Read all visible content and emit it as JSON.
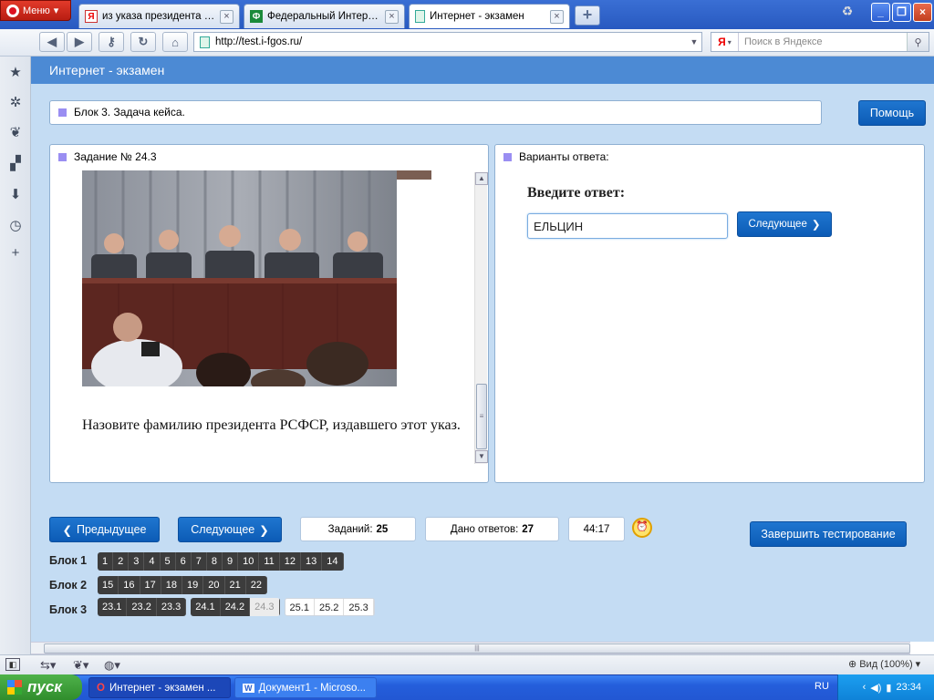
{
  "browser": {
    "menu_label": "Меню",
    "tabs": [
      {
        "title": "из указа президента р...",
        "favicon": "yandex-icon",
        "active": false
      },
      {
        "title": "Федеральный Интерне...",
        "favicon": "fepo-icon",
        "active": false
      },
      {
        "title": "Интернет - экзамен",
        "favicon": "page-icon",
        "active": true
      }
    ],
    "address": "http://test.i-fgos.ru/",
    "search_placeholder": "Поиск в Яндексе",
    "search_engine_letter": "Я"
  },
  "page": {
    "title": "Интернет - экзамен",
    "block_label": "Блок 3. Задача кейса.",
    "help_label": "Помощь",
    "task_header": "Задание № 24.3",
    "question": "Назовите фамилию президента РСФСР, издавшего этот указ.",
    "answers_header": "Варианты ответа:",
    "answer_prompt": "Введите ответ:",
    "answer_value": "ЕЛЬЦИН",
    "answer_next_label": "Следующее"
  },
  "controls": {
    "prev_label": "Предыдущее",
    "next_label": "Следующее",
    "tasks_label": "Заданий:",
    "tasks_count": "25",
    "answered_label": "Дано ответов:",
    "answered_count": "27",
    "timer": "44:17",
    "finish_label": "Завершить тестирование"
  },
  "blocks": [
    {
      "label": "Блок 1",
      "groups": [
        [
          "1",
          "2",
          "3",
          "4",
          "5",
          "6",
          "7",
          "8",
          "9",
          "10",
          "11",
          "12",
          "13",
          "14"
        ]
      ]
    },
    {
      "label": "Блок 2",
      "groups": [
        [
          "15",
          "16",
          "17",
          "18",
          "19",
          "20",
          "21",
          "22"
        ]
      ]
    },
    {
      "label": "Блок 3",
      "groups": [
        [
          "23.1",
          "23.2",
          "23.3"
        ],
        [
          "24.1",
          "24.2",
          "24.3"
        ],
        [
          "25.1",
          "25.2",
          "25.3"
        ]
      ],
      "current": "24.3"
    }
  ],
  "statusbar": {
    "zoom": "Вид (100%)"
  },
  "taskbar": {
    "start_label": "пуск",
    "items": [
      "Интернет - экзамен ...",
      "Документ1 - Microso..."
    ],
    "lang": "RU",
    "clock": "23:34"
  }
}
